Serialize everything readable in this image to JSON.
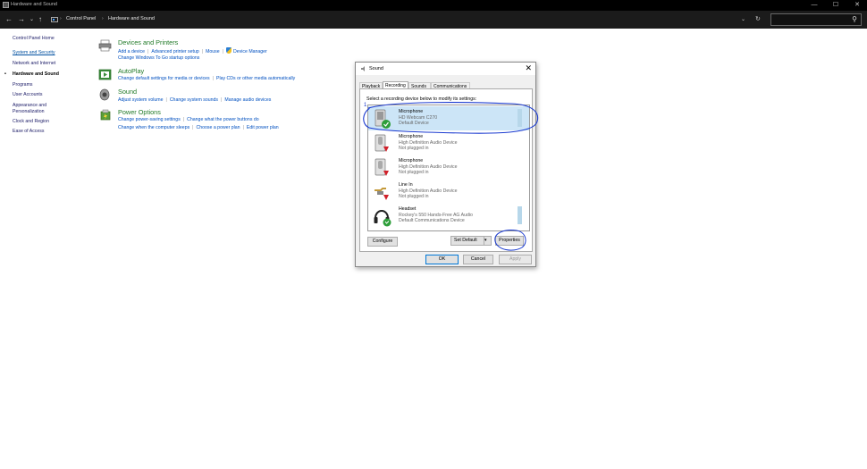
{
  "window": {
    "title": "Hardware and Sound"
  },
  "titlebar_controls": [
    "—",
    "☐",
    "✕"
  ],
  "nav": {
    "back": "←",
    "forward": "→",
    "recent": "⌄",
    "up": "↑"
  },
  "address": {
    "crumbs": [
      "Control Panel",
      "Hardware and Sound"
    ],
    "separator": "›",
    "dropdown": "⌄",
    "refresh": "↻"
  },
  "search": {
    "placeholder": "",
    "icon": "⚲"
  },
  "sidebar": {
    "items": [
      {
        "label": "Control Panel Home",
        "style": "plain"
      },
      {
        "label": "System and Security",
        "style": "link"
      },
      {
        "label": "Network and Internet",
        "style": "plain"
      },
      {
        "label": "Hardware and Sound",
        "style": "current"
      },
      {
        "label": "Programs",
        "style": "plain"
      },
      {
        "label": "User Accounts",
        "style": "plain"
      },
      {
        "label": "Appearance and",
        "style": "plain"
      },
      {
        "label": "Personalization",
        "style": "plain"
      },
      {
        "label": "Clock and Region",
        "style": "plain"
      },
      {
        "label": "Ease of Access",
        "style": "plain"
      }
    ],
    "bullet": "•"
  },
  "categories": [
    {
      "title": "Devices and Printers",
      "icon": "printer-icon",
      "lines": [
        [
          "Add a device",
          "Advanced printer setup",
          "Mouse",
          "Device Manager"
        ],
        [
          "Change Windows To Go startup options"
        ]
      ]
    },
    {
      "title": "AutoPlay",
      "icon": "autoplay-icon",
      "lines": [
        [
          "Change default settings for media or devices",
          "Play CDs or other media automatically"
        ]
      ]
    },
    {
      "title": "Sound",
      "icon": "speaker-icon",
      "lines": [
        [
          "Adjust system volume",
          "Change system sounds",
          "Manage audio devices"
        ]
      ]
    },
    {
      "title": "Power Options",
      "icon": "power-options-icon",
      "lines": [
        [
          "Change power-saving settings",
          "Change what the power buttons do"
        ],
        [
          "Change when the computer sleeps",
          "Choose a power plan",
          "Edit power plan"
        ]
      ]
    }
  ],
  "dialog": {
    "title": "Sound",
    "close": "✕",
    "tabs": [
      "Playback",
      "Recording",
      "Sounds",
      "Communications"
    ],
    "active_tab": "Recording",
    "instruction": "Select a recording device below to modify its settings:",
    "devices": [
      {
        "name": "Microphone",
        "desc1": "HD Webcam C270",
        "desc2": "Default Device",
        "status": "default",
        "selected": true,
        "meter": true
      },
      {
        "name": "Microphone",
        "desc1": "High Definition Audio Device",
        "desc2": "Not plugged in",
        "status": "unplugged",
        "selected": false,
        "meter": false
      },
      {
        "name": "Microphone",
        "desc1": "High Definition Audio Device",
        "desc2": "Not plugged in",
        "status": "unplugged",
        "selected": false,
        "meter": false
      },
      {
        "name": "Line In",
        "desc1": "High Definition Audio Device",
        "desc2": "Not plugged in",
        "status": "unplugged",
        "selected": false,
        "meter": false
      },
      {
        "name": "Headset",
        "desc1": "Rockey's 550 Hands-Free AG Audio",
        "desc2": "Default Communications Device",
        "status": "comm-default",
        "selected": false,
        "meter": true
      }
    ],
    "buttons": {
      "configure": "Configure",
      "set_default": "Set Default",
      "set_default_arrow": "▾",
      "properties": "Properties",
      "ok": "OK",
      "cancel": "Cancel",
      "apply": "Apply"
    }
  },
  "annotation_number": "1",
  "colors": {
    "category_title": "#217a28",
    "link": "#0050c0",
    "selection": "#cce5f7",
    "annotation_ink": "#1a3ad0"
  }
}
